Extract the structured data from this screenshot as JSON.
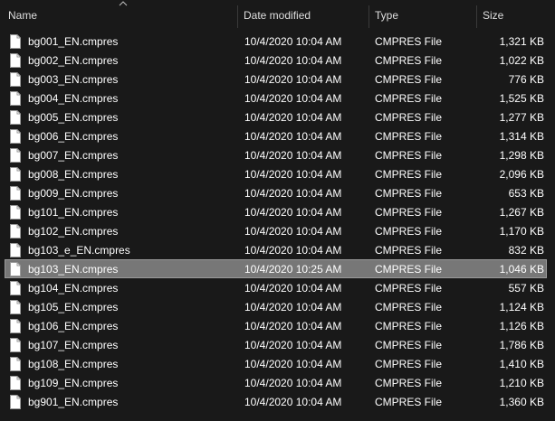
{
  "columns": {
    "name": "Name",
    "date": "Date modified",
    "type": "Type",
    "size": "Size"
  },
  "sort": {
    "column": "name",
    "direction": "ascending",
    "icon": "chevron-up-icon"
  },
  "colors": {
    "background": "#191919",
    "selected_row": "#777777",
    "text": "#ffffff"
  },
  "files": [
    {
      "name": "bg001_EN.cmpres",
      "date": "10/4/2020 10:04 AM",
      "type": "CMPRES File",
      "size": "1,321 KB",
      "selected": false
    },
    {
      "name": "bg002_EN.cmpres",
      "date": "10/4/2020 10:04 AM",
      "type": "CMPRES File",
      "size": "1,022 KB",
      "selected": false
    },
    {
      "name": "bg003_EN.cmpres",
      "date": "10/4/2020 10:04 AM",
      "type": "CMPRES File",
      "size": "776 KB",
      "selected": false
    },
    {
      "name": "bg004_EN.cmpres",
      "date": "10/4/2020 10:04 AM",
      "type": "CMPRES File",
      "size": "1,525 KB",
      "selected": false
    },
    {
      "name": "bg005_EN.cmpres",
      "date": "10/4/2020 10:04 AM",
      "type": "CMPRES File",
      "size": "1,277 KB",
      "selected": false
    },
    {
      "name": "bg006_EN.cmpres",
      "date": "10/4/2020 10:04 AM",
      "type": "CMPRES File",
      "size": "1,314 KB",
      "selected": false
    },
    {
      "name": "bg007_EN.cmpres",
      "date": "10/4/2020 10:04 AM",
      "type": "CMPRES File",
      "size": "1,298 KB",
      "selected": false
    },
    {
      "name": "bg008_EN.cmpres",
      "date": "10/4/2020 10:04 AM",
      "type": "CMPRES File",
      "size": "2,096 KB",
      "selected": false
    },
    {
      "name": "bg009_EN.cmpres",
      "date": "10/4/2020 10:04 AM",
      "type": "CMPRES File",
      "size": "653 KB",
      "selected": false
    },
    {
      "name": "bg101_EN.cmpres",
      "date": "10/4/2020 10:04 AM",
      "type": "CMPRES File",
      "size": "1,267 KB",
      "selected": false
    },
    {
      "name": "bg102_EN.cmpres",
      "date": "10/4/2020 10:04 AM",
      "type": "CMPRES File",
      "size": "1,170 KB",
      "selected": false
    },
    {
      "name": "bg103_e_EN.cmpres",
      "date": "10/4/2020 10:04 AM",
      "type": "CMPRES File",
      "size": "832 KB",
      "selected": false
    },
    {
      "name": "bg103_EN.cmpres",
      "date": "10/4/2020 10:25 AM",
      "type": "CMPRES File",
      "size": "1,046 KB",
      "selected": true
    },
    {
      "name": "bg104_EN.cmpres",
      "date": "10/4/2020 10:04 AM",
      "type": "CMPRES File",
      "size": "557 KB",
      "selected": false
    },
    {
      "name": "bg105_EN.cmpres",
      "date": "10/4/2020 10:04 AM",
      "type": "CMPRES File",
      "size": "1,124 KB",
      "selected": false
    },
    {
      "name": "bg106_EN.cmpres",
      "date": "10/4/2020 10:04 AM",
      "type": "CMPRES File",
      "size": "1,126 KB",
      "selected": false
    },
    {
      "name": "bg107_EN.cmpres",
      "date": "10/4/2020 10:04 AM",
      "type": "CMPRES File",
      "size": "1,786 KB",
      "selected": false
    },
    {
      "name": "bg108_EN.cmpres",
      "date": "10/4/2020 10:04 AM",
      "type": "CMPRES File",
      "size": "1,410 KB",
      "selected": false
    },
    {
      "name": "bg109_EN.cmpres",
      "date": "10/4/2020 10:04 AM",
      "type": "CMPRES File",
      "size": "1,210 KB",
      "selected": false
    },
    {
      "name": "bg901_EN.cmpres",
      "date": "10/4/2020 10:04 AM",
      "type": "CMPRES File",
      "size": "1,360 KB",
      "selected": false
    }
  ]
}
